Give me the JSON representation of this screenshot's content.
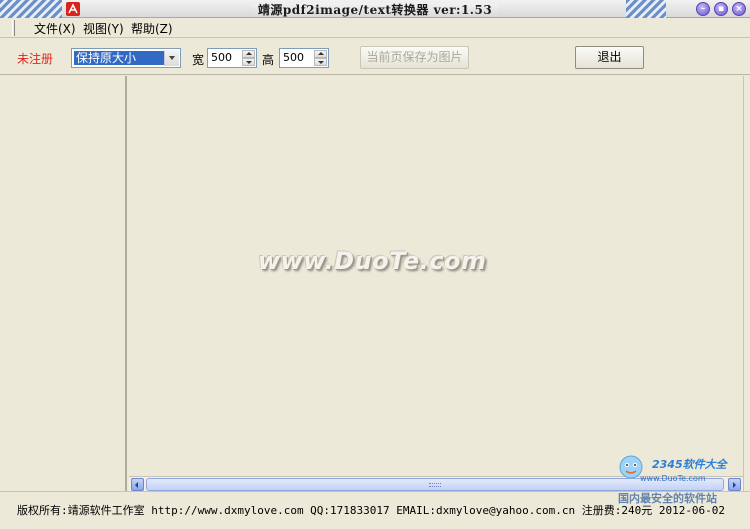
{
  "window": {
    "title": "靖源pdf2image/text转换器 ver:1.53",
    "controls": [
      "minimize-icon",
      "maximize-icon",
      "close-icon"
    ]
  },
  "menu": {
    "items": [
      {
        "label": "文件(X)"
      },
      {
        "label": "视图(Y)"
      },
      {
        "label": "帮助(Z)"
      }
    ]
  },
  "toolbar": {
    "status_label": "未注册",
    "size_mode": {
      "selected": "保持原大小"
    },
    "width_label": "宽",
    "width_value": "500",
    "height_label": "高",
    "height_value": "500",
    "save_page_label": "当前页保存为图片",
    "exit_label": "退出"
  },
  "watermark": "www.DuoTe.com",
  "statusbar": {
    "text": "版权所有:靖源软件工作室 http://www.dxmylove.com QQ:171833017 EMAIL:dxmylove@yahoo.com.cn 注册费:240元 2012-06-02"
  },
  "badge": {
    "title": "2345软件大全",
    "subtitle": "www.DuoTe.com",
    "slogan": "国内最安全的软件站"
  },
  "colors": {
    "unregistered": "#e0281e",
    "selection": "#316ac5",
    "window_bg": "#ece9d8",
    "app_icon": "#d9241c"
  }
}
